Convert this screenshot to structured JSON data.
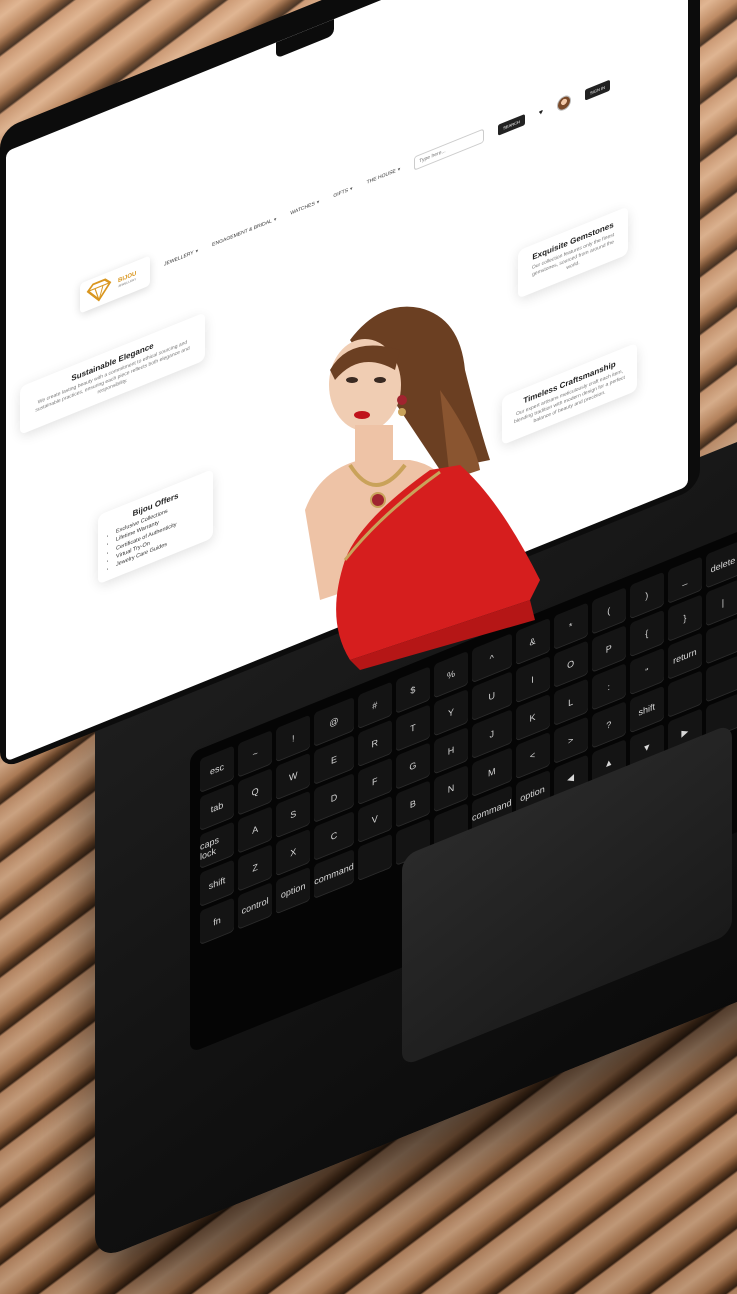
{
  "site": {
    "logo_text": "BIJOU",
    "logo_sub": "JEWELLERY",
    "nav": [
      {
        "label": "JEWELLERY"
      },
      {
        "label": "ENGAGEMENT & BRIDAL"
      },
      {
        "label": "WATCHES"
      },
      {
        "label": "GIFTS"
      },
      {
        "label": "THE HOUSE"
      }
    ],
    "search_placeholder": "Type here...",
    "search_button": "SEARCH",
    "signin_button": "SIGN IN"
  },
  "cards": {
    "sustainable": {
      "title": "Sustainable Elegance",
      "text": "We create lasting beauty with a commitment to ethical sourcing and sustainable practices, ensuring each piece reflects both elegance and responsibility."
    },
    "gemstones": {
      "title": "Exquisite Gemstones",
      "text": "Our collection features only the finest gemstones, sourced from around the world."
    },
    "craftsmanship": {
      "title": "Timeless Craftsmanship",
      "text": "Our expert artisans meticulously craft each item, blending tradition with modern design for a perfect balance of beauty and precision."
    },
    "offers": {
      "title": "Bijou Offers",
      "items": [
        "Exclusive Collections",
        "Lifetime Warranty",
        "Certificate of Authenticity",
        "Virtual Try-On",
        "Jewelry Care Guides"
      ]
    }
  },
  "keyboard": {
    "keys": [
      "esc",
      "~",
      "!",
      "@",
      "#",
      "$",
      "%",
      "^",
      "&",
      "*",
      "(",
      ")",
      "_",
      "delete",
      "tab",
      "Q",
      "W",
      "E",
      "R",
      "T",
      "Y",
      "U",
      "I",
      "O",
      "P",
      "{",
      "}",
      "|",
      "caps lock",
      "A",
      "S",
      "D",
      "F",
      "G",
      "H",
      "J",
      "K",
      "L",
      ":",
      "\"",
      "return",
      "",
      "shift",
      "Z",
      "X",
      "C",
      "V",
      "B",
      "N",
      "M",
      "<",
      ">",
      "?",
      "shift",
      "",
      "",
      "fn",
      "control",
      "option",
      "command",
      "",
      "",
      "",
      "command",
      "option",
      "◀",
      "▲",
      "▼",
      "▶",
      ""
    ]
  },
  "colors": {
    "brand_gold": "#d9961f",
    "saree_red": "#d61e1e",
    "laptop_black": "#0c0c0c"
  }
}
